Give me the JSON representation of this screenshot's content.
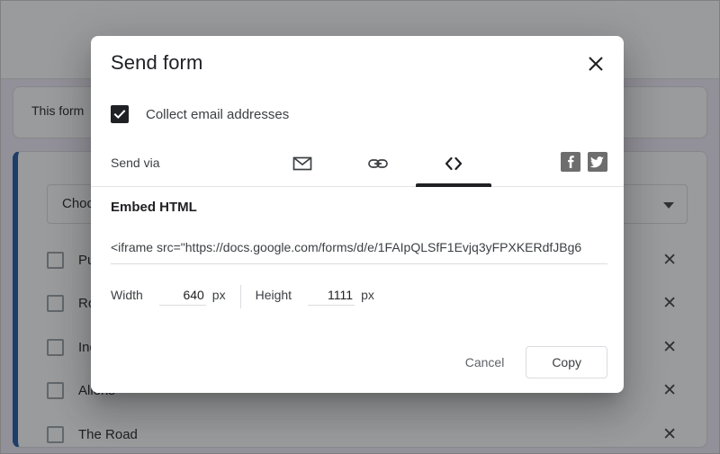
{
  "background": {
    "notice_text": "This form",
    "question": {
      "select_value": "Choose",
      "caret_icon": "chevron-down-icon",
      "options": [
        {
          "label": "Pursu",
          "remove_icon": "close-icon"
        },
        {
          "label": "Rocky",
          "remove_icon": "close-icon"
        },
        {
          "label": "Indep",
          "remove_icon": "close-icon"
        },
        {
          "label": "Aliens",
          "remove_icon": "close-icon"
        },
        {
          "label": "The Road",
          "remove_icon": "close-icon"
        }
      ]
    },
    "accent_color": "#1a56a0"
  },
  "dialog": {
    "title": "Send form",
    "close_icon": "close-icon",
    "collect_email": {
      "label": "Collect email addresses",
      "checked": true,
      "check_icon": "checkmark-icon"
    },
    "send_via": {
      "label": "Send via",
      "tabs": [
        {
          "id": "email",
          "icon": "envelope-icon",
          "active": false
        },
        {
          "id": "link",
          "icon": "link-icon",
          "active": false
        },
        {
          "id": "embed",
          "icon": "code-brackets-icon",
          "active": true
        }
      ],
      "social": [
        {
          "id": "facebook",
          "icon": "facebook-icon"
        },
        {
          "id": "twitter",
          "icon": "twitter-icon"
        }
      ]
    },
    "embed": {
      "heading": "Embed HTML",
      "html_value": "<iframe src=\"https://docs.google.com/forms/d/e/1FAIpQLSfF1Evjq3yFPXKERdfJBg6",
      "width_label": "Width",
      "width_value": "640",
      "width_unit": "px",
      "height_label": "Height",
      "height_value": "1111",
      "height_unit": "px"
    },
    "actions": {
      "cancel_label": "Cancel",
      "copy_label": "Copy"
    }
  }
}
